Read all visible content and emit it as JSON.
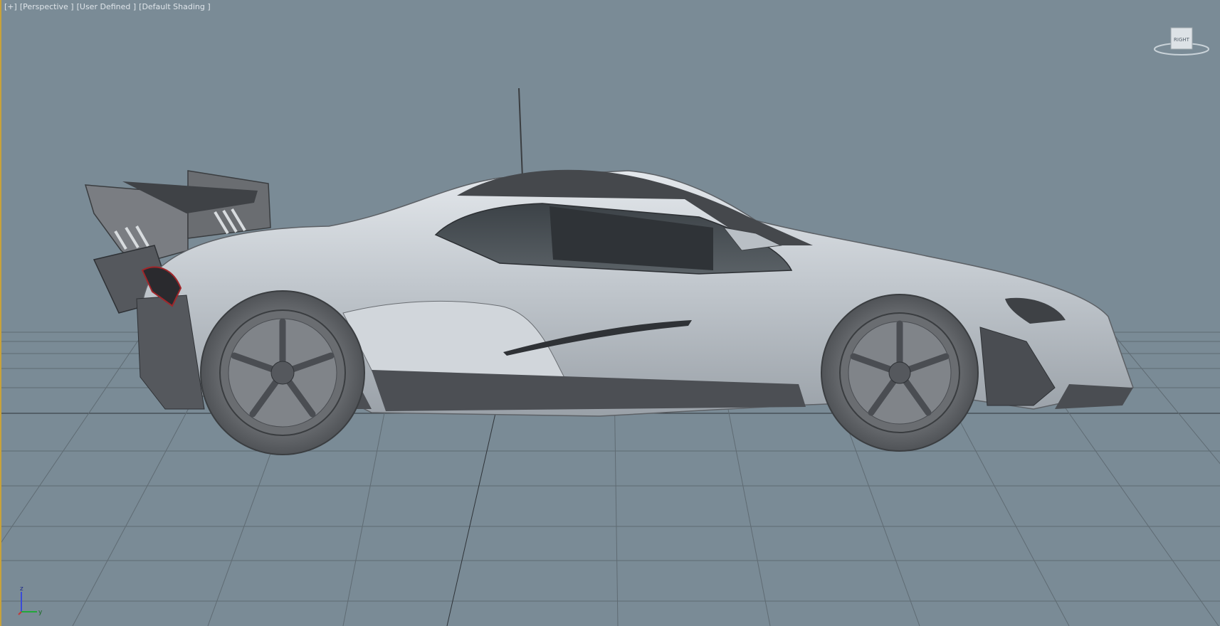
{
  "viewport": {
    "menu": [
      {
        "id": "plus",
        "label": "[+]"
      },
      {
        "id": "view",
        "label": "[Perspective ]"
      },
      {
        "id": "camera",
        "label": "[User Defined ]"
      },
      {
        "id": "shading",
        "label": "[Default Shading ]"
      }
    ],
    "viewcube_face": "RIGHT",
    "axis": {
      "z": "z",
      "y": "y"
    },
    "colors": {
      "background": "#7a8b96",
      "grid": "#5f6b73",
      "body": "#c4cad0",
      "dark_trim": "#4a4d52",
      "accent_border": "#c8a23a",
      "axis_z": "#3a4bd8",
      "axis_y": "#22a83a"
    }
  }
}
